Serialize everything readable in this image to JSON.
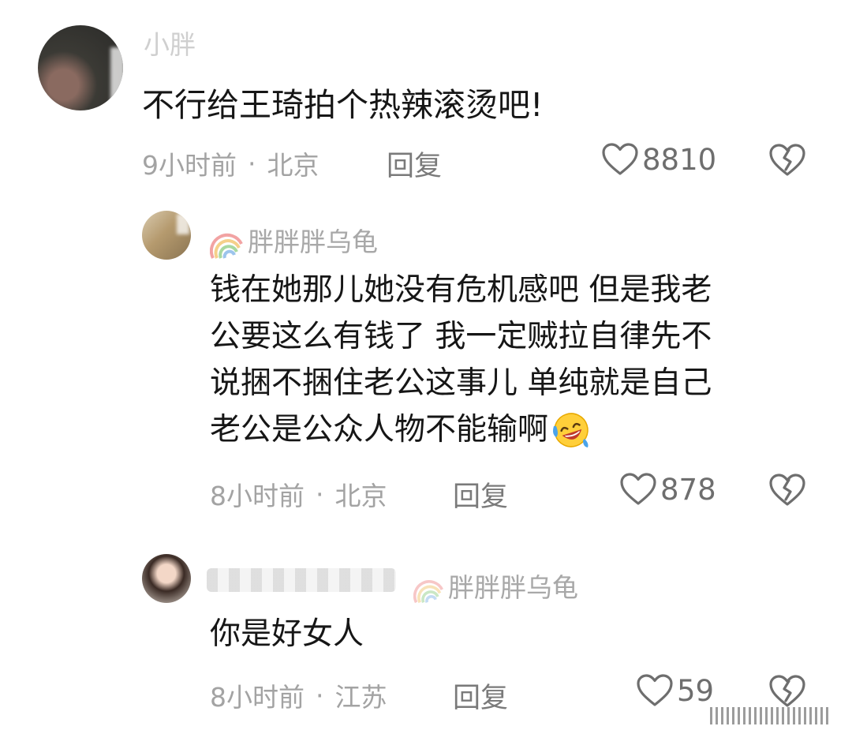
{
  "comments": [
    {
      "username": "小胖",
      "content": "不行给王琦拍个热辣滚烫吧!",
      "time": "9小时前",
      "location": "北京",
      "reply_label": "回复",
      "likes": "8810"
    },
    {
      "username": "胖胖胖乌龟",
      "content_lines": [
        "钱在她那儿她没有危机感吧 但是我老",
        "公要这么有钱了 我一定贼拉自律先不",
        "说捆不捆住老公这事儿 单纯就是自己",
        "老公是公众人物不能输啊"
      ],
      "emoji": "laughing-crying-emoji",
      "time": "8小时前",
      "location": "北京",
      "reply_label": "回复",
      "likes": "878"
    },
    {
      "reply_to": "胖胖胖乌龟",
      "content": "你是好女人",
      "time": "8小时前",
      "location": "江苏",
      "reply_label": "回复",
      "likes": "59"
    }
  ],
  "meta_separator": "·",
  "colors": {
    "text": "#161616",
    "meta": "#a3a3a3",
    "icon": "#6e6e6e"
  }
}
